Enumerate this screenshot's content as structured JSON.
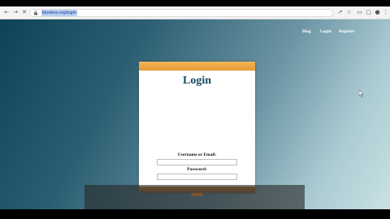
{
  "browser": {
    "url": "bluebox.org/login",
    "icons": {
      "back": "arrow-left-icon",
      "forward": "arrow-right-icon",
      "reload": "close-icon",
      "share": "share-icon",
      "bookmark": "star-icon",
      "extensions": "puzzle-icon",
      "window": "window-icon",
      "profile": "person-icon",
      "menu": "kebab-menu-icon"
    }
  },
  "nav": {
    "blog": "Blog",
    "login": "Login",
    "register": "Register"
  },
  "login_form": {
    "title": "Login",
    "username_label": "Username or Email:",
    "username_value": "",
    "password_label": "Password:",
    "password_value": "",
    "submit_label": ""
  },
  "colors": {
    "accent": "#e89a35",
    "title": "#124c63"
  }
}
